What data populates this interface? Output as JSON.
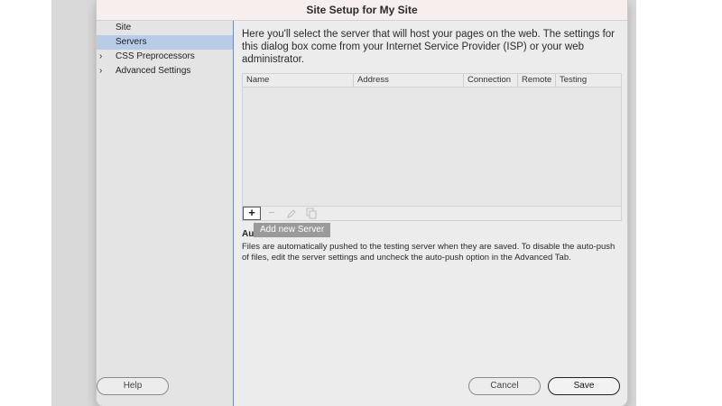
{
  "dialog": {
    "title": "Site Setup for My Site"
  },
  "sidebar": {
    "items": [
      {
        "label": "Site",
        "chevron": ""
      },
      {
        "label": "Servers",
        "chevron": ""
      },
      {
        "label": "CSS Preprocessors",
        "chevron": "›"
      },
      {
        "label": "Advanced Settings",
        "chevron": "›"
      }
    ],
    "selected": "Servers",
    "selected_color": "#b8cce8"
  },
  "intro": "Here you'll select the server that will host your pages on the web. The settings for this dialog box come from your Internet Service Provider (ISP) or your web administrator.",
  "servers_table": {
    "columns": [
      "Name",
      "Address",
      "Connection",
      "Remote",
      "Testing"
    ],
    "rows": []
  },
  "toolbar": {
    "add_label": "+",
    "remove_label": "−",
    "edit_icon": "pencil-icon",
    "duplicate_icon": "duplicate-icon"
  },
  "tooltip": "Add new Server",
  "autopush": {
    "heading": "Au",
    "text": "Files are automatically pushed to the testing server when they are saved. To disable the auto-push of files, edit the server settings and uncheck the auto-push option in the Advanced Tab."
  },
  "buttons": {
    "help": "Help",
    "cancel": "Cancel",
    "save": "Save"
  }
}
